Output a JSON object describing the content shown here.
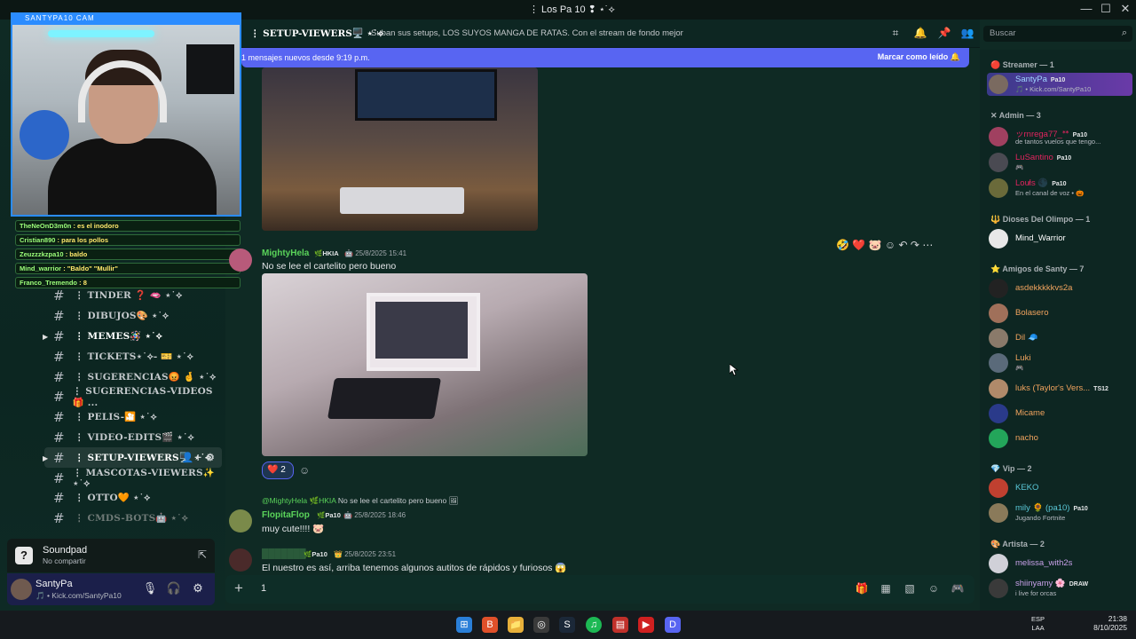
{
  "window": {
    "title": "⋮ Los Pa 10 ❢ ⋆˙⟡",
    "controls": [
      "—",
      "☐",
      "✕"
    ]
  },
  "cam": {
    "label": "SANTYPA10 CAM"
  },
  "overlay_chat": [
    {
      "user": "TheNeOnD3m0n",
      "text": ": es el inodoro"
    },
    {
      "user": "Cristian890",
      "text": ": para los pollos"
    },
    {
      "user": "Zeuzzzkzpa10",
      "text": ": baldo"
    },
    {
      "user": "Mind_warrior",
      "text": ": \"Baldo\" \"Mullir\""
    },
    {
      "user": "Franco_Tremendo",
      "text": ": 8"
    }
  ],
  "channels": [
    {
      "label": "⋮ TINDER ❓ 🫦 ⋆˙⟡",
      "state": "normal"
    },
    {
      "label": "⋮ DIBUJOS🎨 ⋆˙⟡",
      "state": "normal"
    },
    {
      "label": "⋮ MEMES🪅 ⋆˙⟡",
      "state": "bright"
    },
    {
      "label": "⋮ TICKETS⋆˙⟡- 🎫 ⋆˙⟡",
      "state": "normal"
    },
    {
      "label": "⋮ SUGERENCIAS😡 🤞 ⋆˙⟡",
      "state": "normal"
    },
    {
      "label": "⋮ SUGERENCIAS-VIDEOS🎁 ...",
      "state": "normal"
    },
    {
      "label": "⋮ PELIS-🎦 ⋆˙⟡",
      "state": "normal"
    },
    {
      "label": "⋮ VIDEO-EDITS🎬 ⋆˙⟡",
      "state": "normal"
    },
    {
      "label": "⋮ SETUP-VIEWERS🖥️ ⋆˙⟡",
      "state": "active"
    },
    {
      "label": "⋮ MASCOTAS-VIEWERS✨ ⋆˙⟡",
      "state": "normal"
    },
    {
      "label": "⋮ OTTO🧡 ⋆˙⟡",
      "state": "normal"
    },
    {
      "label": "⋮ CMDS-BOTS🤖 ⋆˙⟡",
      "state": "dim"
    }
  ],
  "soundpad": {
    "title": "Soundpad",
    "subtitle": "No compartir"
  },
  "user_panel": {
    "name": "SantyPa",
    "status": "🎵 • Kick.com/SantyPa10"
  },
  "channel_header": {
    "name": "⋮ SETUP-VIEWERS🖥️ ⋆˙⟡",
    "topic": "Suban sus setups, LOS SUYOS MANGA DE RATAS. Con el stream de fondo mejor"
  },
  "search": {
    "placeholder": "Buscar"
  },
  "new_messages_bar": {
    "text": "1 mensajes nuevos desde 9:19 p.m.",
    "action": "Marcar como leído"
  },
  "messages": {
    "m1": {
      "author": "MightyHela",
      "badge": "HKIA",
      "timestamp": "25/8/2025 15:41",
      "text": "No se lee el cartelito pero bueno"
    },
    "reaction": {
      "emoji": "❤️",
      "count": "2"
    },
    "reply_preview": {
      "user": "@MightyHela",
      "badge": "HKIA",
      "text": "No se lee el cartelito pero bueno"
    },
    "m2": {
      "author": "FlopitaFlop",
      "badge": "Pa10",
      "timestamp": "25/8/2025 18:46",
      "text": "muy cute!!!! 🐷"
    },
    "m3": {
      "badge": "Pa10",
      "timestamp": "25/8/2025 23:51",
      "text": "El nuestro es así, arriba tenemos algunos autitos de rápidos y furiosos 😱"
    }
  },
  "composer": {
    "value": "1"
  },
  "members": {
    "groups": [
      {
        "label": "Streamer — 1"
      },
      {
        "label": "Admin — 3"
      },
      {
        "label": "Dioses Del Olimpo — 1"
      },
      {
        "label": "Amigos de Santy — 7"
      },
      {
        "label": "Vip — 2"
      },
      {
        "label": "Artista — 2"
      }
    ],
    "list": [
      {
        "name": "SantyPa",
        "tag": "Pa10",
        "status": "🎵 • Kick.com/SantyPa10",
        "color": "#ffffff"
      },
      {
        "name": "ッrnrega77_ᕯ",
        "tag": "Pa10",
        "status": "de tantos vuelos que tengo...",
        "color": "#e0245e"
      },
      {
        "name": "LuSantino",
        "tag": "Pa10",
        "status": "🎮",
        "color": "#e0245e"
      },
      {
        "name": "Lou̸is 🌑",
        "tag": "Pa10",
        "status": "En el canal de voz • 🎃",
        "color": "#e0245e"
      },
      {
        "name": "Mind_Warrior",
        "tag": "",
        "status": "",
        "color": "#ffffff"
      },
      {
        "name": "asdekkkkkvs2a",
        "tag": "",
        "status": "",
        "color": "#f0a35e"
      },
      {
        "name": "Bolasero",
        "tag": "",
        "status": "",
        "color": "#f0a35e"
      },
      {
        "name": "Dil 🧢",
        "tag": "",
        "status": "",
        "color": "#f0a35e"
      },
      {
        "name": "Luki",
        "tag": "",
        "status": "🎮",
        "color": "#f0a35e"
      },
      {
        "name": "luks (Taylor's Vers...",
        "tag": "TS12",
        "status": "",
        "color": "#f0a35e"
      },
      {
        "name": "Micame",
        "tag": "",
        "status": "",
        "color": "#f0a35e"
      },
      {
        "name": "nacho",
        "tag": "",
        "status": "",
        "color": "#f0a35e"
      },
      {
        "name": "KEKO",
        "tag": "",
        "status": "",
        "color": "#5ac8d8"
      },
      {
        "name": "mily 🌻 (pa10)",
        "tag": "Pa10",
        "status": "Jugando Fortnite",
        "color": "#5ac8d8"
      },
      {
        "name": "melissa_with2s",
        "tag": "",
        "status": "",
        "color": "#c7a0e8"
      },
      {
        "name": "shiinyamy 🌸",
        "tag": "DRAW",
        "status": "i live for orcas",
        "color": "#c7a0e8"
      }
    ]
  },
  "taskbar": {
    "icons": [
      "⊞",
      "B",
      "📁",
      "◎",
      "S",
      "♫",
      "▤",
      "▶",
      "D"
    ],
    "lang": "ESP\nLAA",
    "time": "21:38",
    "date": "8/10/2025"
  },
  "colors": {
    "accent": "#5865f2",
    "bg": "#0f2a24",
    "online": "#23a55a"
  }
}
